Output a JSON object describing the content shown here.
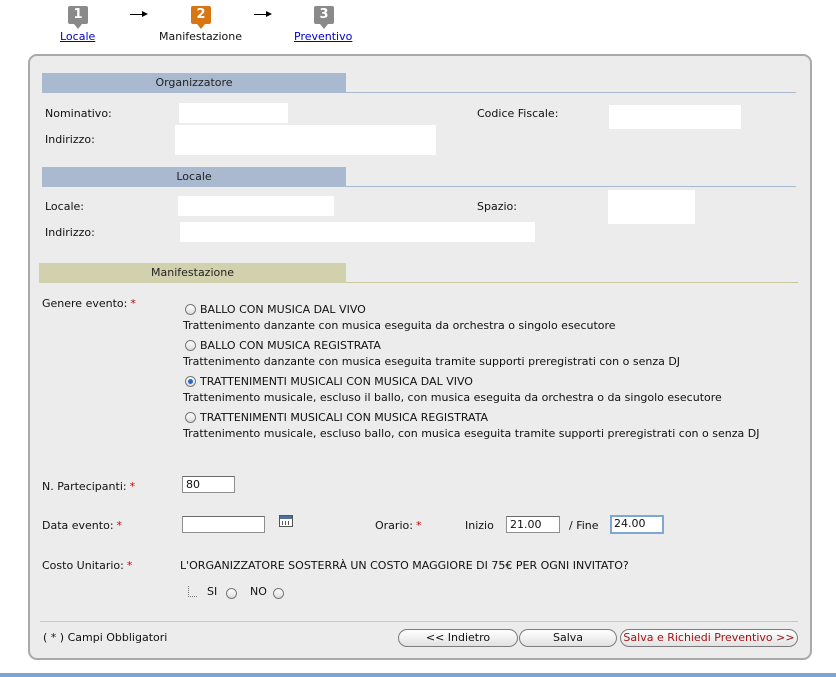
{
  "stepper": {
    "steps": [
      {
        "number": "1",
        "label": "Locale",
        "color": "#8a8a8a",
        "link": true
      },
      {
        "number": "2",
        "label": "Manifestazione",
        "color": "#d77612",
        "link": false
      },
      {
        "number": "3",
        "label": "Preventivo",
        "color": "#8a8a8a",
        "link": true
      }
    ]
  },
  "organizzatore": {
    "header": "Organizzatore",
    "nominativo_label": "Nominativo:",
    "nominativo_value": "",
    "codice_fiscale_label": "Codice Fiscale:",
    "codice_fiscale_value": "",
    "indirizzo_label": "Indirizzo:",
    "indirizzo_value": ""
  },
  "locale": {
    "header": "Locale",
    "locale_label": "Locale:",
    "locale_value": "",
    "spazio_label": "Spazio:",
    "spazio_value": "",
    "indirizzo_label": "Indirizzo:",
    "indirizzo_value": ""
  },
  "manifestazione": {
    "header": "Manifestazione",
    "genere_label": "Genere evento:",
    "options": [
      {
        "title": "BALLO CON MUSICA DAL VIVO",
        "desc": "Trattenimento danzante con musica eseguita da orchestra o singolo esecutore",
        "checked": false
      },
      {
        "title": "BALLO CON MUSICA REGISTRATA",
        "desc": "Trattenimento danzante con musica eseguita tramite supporti preregistrati con o senza DJ",
        "checked": false
      },
      {
        "title": "TRATTENIMENTI MUSICALI CON MUSICA DAL VIVO",
        "desc": "Trattenimento musicale, escluso il ballo, con musica eseguita da orchestra o da singolo esecutore",
        "checked": true
      },
      {
        "title": "TRATTENIMENTI MUSICALI CON MUSICA REGISTRATA",
        "desc": "Trattenimento musicale, escluso ballo, con musica eseguita tramite supporti preregistrati con o senza DJ",
        "checked": false
      }
    ],
    "partecipanti_label": "N. Partecipanti:",
    "partecipanti_value": "80",
    "data_label": "Data evento:",
    "data_value": "",
    "orario_label": "Orario:",
    "inizio_label": "Inizio",
    "inizio_value": "21.00",
    "fine_label": "/ Fine",
    "fine_value": "24.00",
    "costo_label": "Costo Unitario:",
    "costo_question": "L'ORGANIZZATORE SOSTERRÀ UN COSTO MAGGIORE DI 75€ PER OGNI INVITATO?",
    "si_label": "SI",
    "no_label": "NO"
  },
  "footer": {
    "required_note": "( * ) Campi Obbligatori",
    "back_button": "<< Indietro",
    "save_button": "Salva",
    "save_request_button": "Salva e Richiedi Preventivo >>"
  },
  "required_marker": "*",
  "colors": {
    "header_blue": "#a9b9cf",
    "header_khaki": "#d2d1ad",
    "step_active": "#d77612",
    "step_inactive": "#8a8a8a",
    "required": "#cc0000",
    "save_request_text": "#a31313"
  }
}
